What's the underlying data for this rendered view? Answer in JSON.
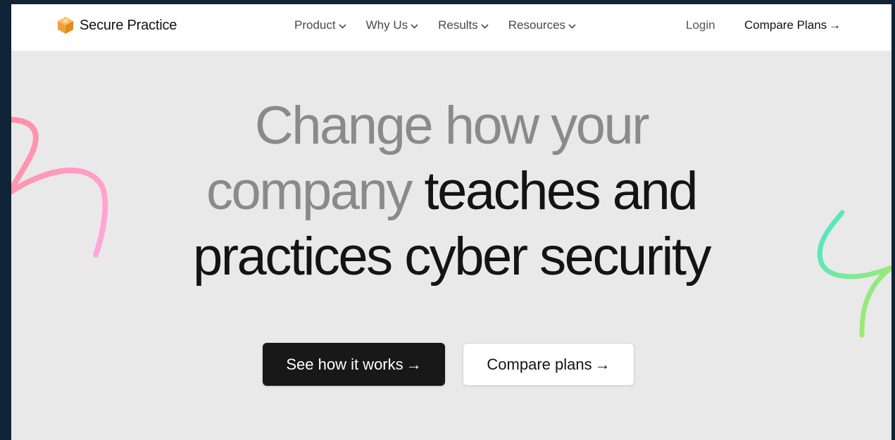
{
  "brand": {
    "name": "Secure Practice",
    "logo_icon": "hexagon-cube-logo",
    "logo_color": "#f0a23a"
  },
  "nav": {
    "items": [
      {
        "label": "Product",
        "icon": "chevron-down-icon"
      },
      {
        "label": "Why Us",
        "icon": "chevron-down-icon"
      },
      {
        "label": "Results",
        "icon": "chevron-down-icon"
      },
      {
        "label": "Resources",
        "icon": "chevron-down-icon"
      }
    ],
    "login_label": "Login",
    "cta_label": "Compare Plans",
    "cta_arrow": "→"
  },
  "hero": {
    "line1_grey": "Change how your",
    "line2_grey": "company",
    "line2_dark": "teaches and",
    "line3_dark": "practices cyber security",
    "primary_button": {
      "label": "See how it works",
      "arrow": "→"
    },
    "secondary_button": {
      "label": "Compare plans",
      "arrow": "→"
    }
  },
  "colors": {
    "headline_grey": "#8a8a8a",
    "headline_dark": "#141414",
    "primary_button_bg": "#181818",
    "squiggle_left": [
      "#ff8fa3",
      "#ffa3d8"
    ],
    "squiggle_right": [
      "#5ae8c4",
      "#a6e86a"
    ]
  }
}
